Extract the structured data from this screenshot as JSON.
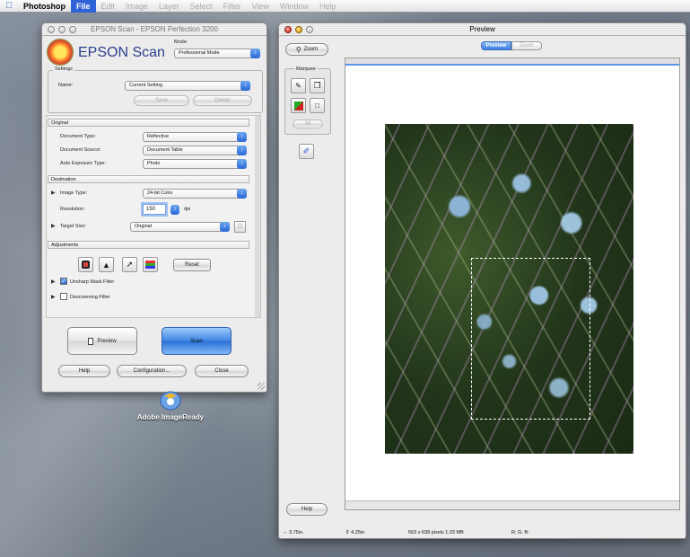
{
  "menubar": {
    "app": "Photoshop",
    "items": [
      "File",
      "Edit",
      "Image",
      "Layer",
      "Select",
      "Filter",
      "View",
      "Window",
      "Help"
    ],
    "active": "File"
  },
  "epson": {
    "window_title": "EPSON Scan - EPSON Perfection 3200",
    "logo_text": "EPSON Scan",
    "mode_label": "Mode:",
    "mode_value": "Professional Mode",
    "settings": {
      "group": "Settings",
      "name_label": "Name:",
      "name_value": "Current Setting",
      "save": "Save",
      "delete": "Delete"
    },
    "original": {
      "header": "Original",
      "doc_type_label": "Document Type:",
      "doc_type_value": "Reflective",
      "doc_source_label": "Document Source:",
      "doc_source_value": "Document Table",
      "auto_exposure_label": "Auto Exposure Type:",
      "auto_exposure_value": "Photo"
    },
    "destination": {
      "header": "Destination",
      "image_type_label": "Image Type:",
      "image_type_value": "24-bit Color",
      "resolution_label": "Resolution:",
      "resolution_value": "150",
      "resolution_unit": "dpi",
      "target_size_label": "Target Size:",
      "target_size_value": "Original"
    },
    "adjustments": {
      "header": "Adjustments",
      "reset": "Reset",
      "unsharp_mask": "Unsharp Mask Filter",
      "unsharp_checked": true,
      "descreening": "Descreening Filter",
      "descreening_checked": false
    },
    "buttons": {
      "preview": "Preview",
      "scan": "Scan",
      "help": "Help",
      "configuration": "Configuration...",
      "close": "Close"
    }
  },
  "desktop": {
    "icon_label": "Adobe ImageReady"
  },
  "preview_window": {
    "title": "Preview",
    "zoom_button": "Zoom",
    "tabs": [
      "Preview",
      "Zoom"
    ],
    "marquee_group": "Marquee",
    "all_button": "All",
    "help_button": "Help",
    "status": {
      "width": "3.75in.",
      "height": "4.25in.",
      "pixels": "563 x 638 pixels 1.03 MB",
      "rgb": "R: G: B:"
    }
  }
}
